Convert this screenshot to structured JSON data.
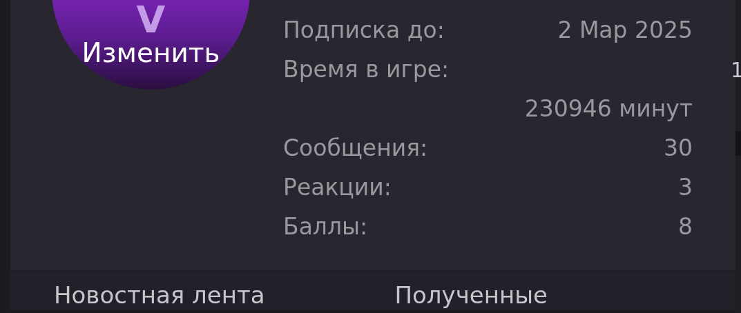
{
  "profile_card": {
    "avatar": {
      "letter": "V",
      "action": "Изменить"
    },
    "stats": [
      {
        "label": "Подписка до:",
        "value": "2 Мар 2025",
        "kind": "inline"
      },
      {
        "label": "Время в игре:",
        "value": "230946 минут",
        "kind": "wrapped"
      },
      {
        "label": "Сообщения:",
        "value": "30",
        "kind": "inline"
      },
      {
        "label": "Реакции:",
        "value": "3",
        "kind": "inline"
      },
      {
        "label": "Баллы:",
        "value": "8",
        "kind": "inline"
      }
    ]
  },
  "menu": [
    "Новостная лента",
    "Полученные"
  ],
  "background_fragment": "1"
}
